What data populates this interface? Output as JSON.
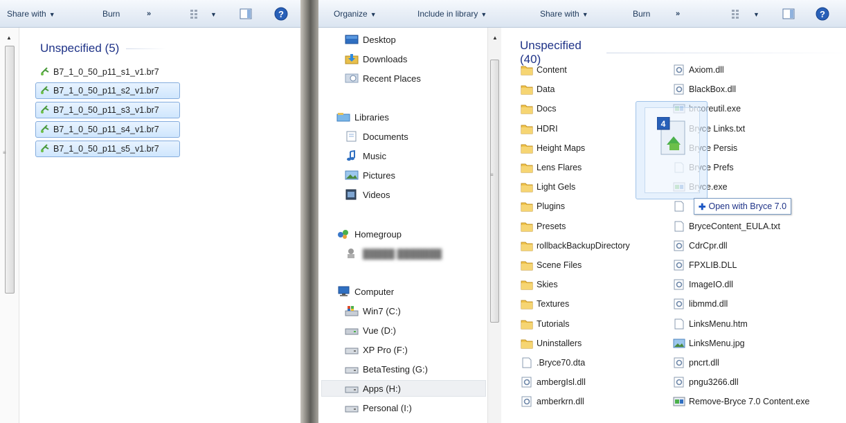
{
  "left_window": {
    "toolbar": {
      "share_with": "Share with",
      "burn": "Burn",
      "more": "»"
    },
    "group": {
      "label": "Unspecified (5)"
    },
    "files": [
      {
        "name": "B7_1_0_50_p11_s1_v1.br7",
        "selected": false
      },
      {
        "name": "B7_1_0_50_p11_s2_v1.br7",
        "selected": true
      },
      {
        "name": "B7_1_0_50_p11_s3_v1.br7",
        "selected": true
      },
      {
        "name": "B7_1_0_50_p11_s4_v1.br7",
        "selected": true
      },
      {
        "name": "B7_1_0_50_p11_s5_v1.br7",
        "selected": true
      }
    ]
  },
  "right_window": {
    "toolbar": {
      "organize": "Organize",
      "include_in_library": "Include in library",
      "share_with": "Share with",
      "burn": "Burn",
      "more": "»"
    },
    "nav": {
      "desktop": "Desktop",
      "downloads": "Downloads",
      "recent_places": "Recent Places",
      "libraries": "Libraries",
      "documents": "Documents",
      "music": "Music",
      "pictures": "Pictures",
      "videos": "Videos",
      "homegroup": "Homegroup",
      "computer": "Computer",
      "drives": [
        "Win7 (C:)",
        "Vue (D:)",
        "XP Pro (F:)",
        "BetaTesting (G:)",
        "Apps (H:)",
        "Personal (I:)"
      ]
    },
    "group": {
      "label": "Unspecified (40)"
    },
    "column1": [
      {
        "name": "Content",
        "type": "folder"
      },
      {
        "name": "Data",
        "type": "folder"
      },
      {
        "name": "Docs",
        "type": "folder"
      },
      {
        "name": "HDRI",
        "type": "folder"
      },
      {
        "name": "Height Maps",
        "type": "folder"
      },
      {
        "name": "Lens Flares",
        "type": "folder"
      },
      {
        "name": "Light Gels",
        "type": "folder"
      },
      {
        "name": "Plugins",
        "type": "folder"
      },
      {
        "name": "Presets",
        "type": "folder"
      },
      {
        "name": "rollbackBackupDirectory",
        "type": "folder"
      },
      {
        "name": "Scene Files",
        "type": "folder"
      },
      {
        "name": "Skies",
        "type": "folder"
      },
      {
        "name": "Textures",
        "type": "folder"
      },
      {
        "name": "Tutorials",
        "type": "folder"
      },
      {
        "name": "Uninstallers",
        "type": "folder"
      },
      {
        "name": ".Bryce70.dta",
        "type": "file"
      },
      {
        "name": "ambergIsl.dll",
        "type": "dll"
      },
      {
        "name": "amberkrn.dll",
        "type": "dll"
      }
    ],
    "column2": [
      {
        "name": "Axiom.dll",
        "type": "dll"
      },
      {
        "name": "BlackBox.dll",
        "type": "dll"
      },
      {
        "name": "brcoreutil.exe",
        "type": "exe"
      },
      {
        "name": "Bryce Links.txt",
        "type": "file"
      },
      {
        "name": "Bryce Persis",
        "type": "file"
      },
      {
        "name": "Bryce Prefs",
        "type": "file"
      },
      {
        "name": "Bryce.exe",
        "type": "exe"
      },
      {
        "name": "",
        "type": "file"
      },
      {
        "name": "BryceContent_EULA.txt",
        "type": "file"
      },
      {
        "name": "CdrCpr.dll",
        "type": "dll"
      },
      {
        "name": "FPXLIB.DLL",
        "type": "dll"
      },
      {
        "name": "ImageIO.dll",
        "type": "dll"
      },
      {
        "name": "libmmd.dll",
        "type": "dll"
      },
      {
        "name": "LinksMenu.htm",
        "type": "file"
      },
      {
        "name": "LinksMenu.jpg",
        "type": "image"
      },
      {
        "name": "pncrt.dll",
        "type": "dll"
      },
      {
        "name": "pngu3266.dll",
        "type": "dll"
      },
      {
        "name": "Remove-Bryce 7.0 Content.exe",
        "type": "exe"
      }
    ],
    "drag": {
      "badge_count": "4",
      "tooltip": "Open with Bryce 7.0"
    }
  }
}
